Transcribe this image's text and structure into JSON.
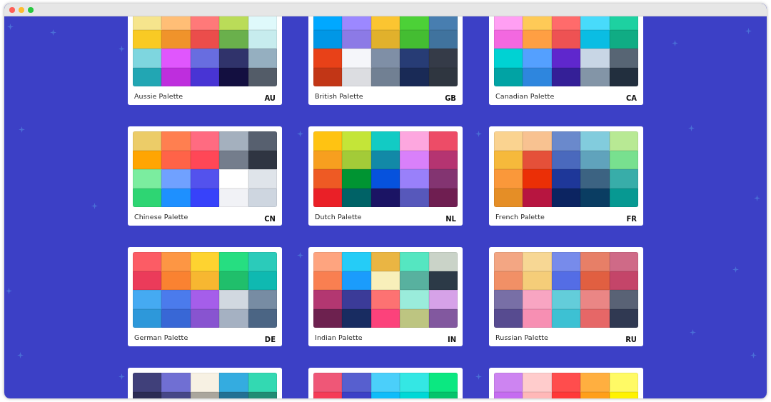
{
  "palettes": [
    {
      "name": "Aussie Palette",
      "code": "AU",
      "swatches": [
        {
          "color": "#f6e58d"
        },
        {
          "color": "#ffbe76"
        },
        {
          "color": "#ff7979"
        },
        {
          "color": "#badc58"
        },
        {
          "color": "#dff9fb"
        },
        {
          "color": "#f9ca24"
        },
        {
          "color": "#f0932b"
        },
        {
          "color": "#eb4d4b"
        },
        {
          "color": "#6ab04c"
        },
        {
          "color": "#c7ecee"
        },
        {
          "color": "#7ed6df"
        },
        {
          "color": "#e056fd"
        },
        {
          "color": "#686de0"
        },
        {
          "color": "#30336b"
        },
        {
          "color": "#95afc0"
        },
        {
          "color": "#22a6b3"
        },
        {
          "color": "#be2edd"
        },
        {
          "color": "#4834d4"
        },
        {
          "color": "#130f40"
        },
        {
          "color": "#535c68"
        }
      ]
    },
    {
      "name": "British Palette",
      "code": "GB",
      "swatches": [
        {
          "color": "#00a8ff"
        },
        {
          "color": "#9c88ff"
        },
        {
          "color": "#fbc531"
        },
        {
          "color": "#4cd137"
        },
        {
          "color": "#487eb0"
        },
        {
          "color": "#0097e6"
        },
        {
          "color": "#8c7ae6"
        },
        {
          "color": "#e1b12c"
        },
        {
          "color": "#44bd32"
        },
        {
          "color": "#40739e"
        },
        {
          "color": "#e84118"
        },
        {
          "color": "#f5f6fa"
        },
        {
          "color": "#7f8fa6"
        },
        {
          "color": "#273c75"
        },
        {
          "color": "#353b48"
        },
        {
          "color": "#c23616"
        },
        {
          "color": "#dcdde1"
        },
        {
          "color": "#718093"
        },
        {
          "color": "#192a56"
        },
        {
          "color": "#2f3640"
        }
      ]
    },
    {
      "name": "Canadian Palette",
      "code": "CA",
      "swatches": [
        {
          "color": "#ff9ff3"
        },
        {
          "color": "#feca57"
        },
        {
          "color": "#ff6b6b"
        },
        {
          "color": "#48dbfb"
        },
        {
          "color": "#1dd1a1"
        },
        {
          "color": "#f368e0"
        },
        {
          "color": "#ff9f43"
        },
        {
          "color": "#ee5253"
        },
        {
          "color": "#0abde3"
        },
        {
          "color": "#10ac84"
        },
        {
          "color": "#00d2d3"
        },
        {
          "color": "#54a0ff"
        },
        {
          "color": "#5f27cd"
        },
        {
          "color": "#c8d6e5"
        },
        {
          "color": "#576574"
        },
        {
          "color": "#01a3a4"
        },
        {
          "color": "#2e86de"
        },
        {
          "color": "#341f97"
        },
        {
          "color": "#8395a7"
        },
        {
          "color": "#222f3e"
        }
      ]
    },
    {
      "name": "Chinese Palette",
      "code": "CN",
      "swatches": [
        {
          "color": "#eccc68"
        },
        {
          "color": "#ff7f50"
        },
        {
          "color": "#ff6b81"
        },
        {
          "color": "#a4b0be"
        },
        {
          "color": "#57606f"
        },
        {
          "color": "#ffa502"
        },
        {
          "color": "#ff6348"
        },
        {
          "color": "#ff4757"
        },
        {
          "color": "#747d8c"
        },
        {
          "color": "#2f3542"
        },
        {
          "color": "#7bed9f"
        },
        {
          "color": "#70a1ff"
        },
        {
          "color": "#5352ed"
        },
        {
          "color": "#ffffff"
        },
        {
          "color": "#dfe4ea"
        },
        {
          "color": "#2ed573"
        },
        {
          "color": "#1e90ff"
        },
        {
          "color": "#3742fa"
        },
        {
          "color": "#f1f2f6"
        },
        {
          "color": "#ced6e0"
        }
      ]
    },
    {
      "name": "Dutch Palette",
      "code": "NL",
      "swatches": [
        {
          "color": "#ffc312"
        },
        {
          "color": "#c4e538"
        },
        {
          "color": "#12cbc4"
        },
        {
          "color": "#fda7df"
        },
        {
          "color": "#ed4c67"
        },
        {
          "color": "#f79f1f"
        },
        {
          "color": "#a3cb38"
        },
        {
          "color": "#1289a7"
        },
        {
          "color": "#d980fa"
        },
        {
          "color": "#b53471"
        },
        {
          "color": "#ee5a24"
        },
        {
          "color": "#009432"
        },
        {
          "color": "#0652dd"
        },
        {
          "color": "#9980fa"
        },
        {
          "color": "#833471"
        },
        {
          "color": "#ea2027"
        },
        {
          "color": "#006266"
        },
        {
          "color": "#1b1464"
        },
        {
          "color": "#5758bb"
        },
        {
          "color": "#6f1e51"
        }
      ]
    },
    {
      "name": "French Palette",
      "code": "FR",
      "swatches": [
        {
          "color": "#fad390"
        },
        {
          "color": "#f8c291"
        },
        {
          "color": "#6a89cc"
        },
        {
          "color": "#82ccdd"
        },
        {
          "color": "#b8e994"
        },
        {
          "color": "#f6b93b"
        },
        {
          "color": "#e55039"
        },
        {
          "color": "#4a69bd"
        },
        {
          "color": "#60a3bc"
        },
        {
          "color": "#78e08f"
        },
        {
          "color": "#fa983a"
        },
        {
          "color": "#eb2f06"
        },
        {
          "color": "#1e3799"
        },
        {
          "color": "#3c6382"
        },
        {
          "color": "#38ada9"
        },
        {
          "color": "#e58e26"
        },
        {
          "color": "#b71540"
        },
        {
          "color": "#0c2461"
        },
        {
          "color": "#0a3d62"
        },
        {
          "color": "#079992"
        }
      ]
    },
    {
      "name": "German Palette",
      "code": "DE",
      "swatches": [
        {
          "color": "#fc5c65"
        },
        {
          "color": "#fd9644"
        },
        {
          "color": "#fed330"
        },
        {
          "color": "#26de81"
        },
        {
          "color": "#2bcbba"
        },
        {
          "color": "#eb3b5a"
        },
        {
          "color": "#fa8231"
        },
        {
          "color": "#f7b731"
        },
        {
          "color": "#20bf6b"
        },
        {
          "color": "#0fb9b1"
        },
        {
          "color": "#45aaf2"
        },
        {
          "color": "#4b7bec"
        },
        {
          "color": "#a55eea"
        },
        {
          "color": "#d1d8e0"
        },
        {
          "color": "#778ca3"
        },
        {
          "color": "#2d98da"
        },
        {
          "color": "#3867d6"
        },
        {
          "color": "#8854d0"
        },
        {
          "color": "#a5b1c2"
        },
        {
          "color": "#4b6584"
        }
      ]
    },
    {
      "name": "Indian Palette",
      "code": "IN",
      "swatches": [
        {
          "color": "#fea47f"
        },
        {
          "color": "#25ccf7"
        },
        {
          "color": "#eab543"
        },
        {
          "color": "#55e6c1"
        },
        {
          "color": "#cad3c8"
        },
        {
          "color": "#f97f51"
        },
        {
          "color": "#1b9cfc"
        },
        {
          "color": "#f8efba"
        },
        {
          "color": "#58b19f"
        },
        {
          "color": "#2c3a47"
        },
        {
          "color": "#b33771"
        },
        {
          "color": "#3b3b98"
        },
        {
          "color": "#fd7272"
        },
        {
          "color": "#9aecdb"
        },
        {
          "color": "#d6a2e8"
        },
        {
          "color": "#6d214f"
        },
        {
          "color": "#182c61"
        },
        {
          "color": "#fc427b"
        },
        {
          "color": "#bdc581"
        },
        {
          "color": "#82589f"
        }
      ]
    },
    {
      "name": "Russian Palette",
      "code": "RU",
      "swatches": [
        {
          "color": "#f3a683"
        },
        {
          "color": "#f7d794"
        },
        {
          "color": "#778beb"
        },
        {
          "color": "#e77f67"
        },
        {
          "color": "#cf6a87"
        },
        {
          "color": "#f19066"
        },
        {
          "color": "#f5cd79"
        },
        {
          "color": "#546de5"
        },
        {
          "color": "#e15f41"
        },
        {
          "color": "#c44569"
        },
        {
          "color": "#786fa6"
        },
        {
          "color": "#f8a5c2"
        },
        {
          "color": "#63cdda"
        },
        {
          "color": "#ea8685"
        },
        {
          "color": "#596275"
        },
        {
          "color": "#574b90"
        },
        {
          "color": "#f78fb3"
        },
        {
          "color": "#3dc1d3"
        },
        {
          "color": "#e66767"
        },
        {
          "color": "#303952"
        }
      ]
    },
    {
      "swatches": [
        {
          "color": "#40407a"
        },
        {
          "color": "#706fd3"
        },
        {
          "color": "#f7f1e3"
        },
        {
          "color": "#34ace0"
        },
        {
          "color": "#33d9b2"
        },
        {
          "color": "#2c2c54"
        },
        {
          "color": "#474787"
        },
        {
          "color": "#aaa69d"
        },
        {
          "color": "#227093"
        },
        {
          "color": "#218c74"
        }
      ]
    },
    {
      "swatches": [
        {
          "color": "#ef5777"
        },
        {
          "color": "#575fcf"
        },
        {
          "color": "#4bcffa"
        },
        {
          "color": "#34e7e4"
        },
        {
          "color": "#0be881"
        },
        {
          "color": "#f53b57"
        },
        {
          "color": "#3c40c6"
        },
        {
          "color": "#0fbcf9"
        },
        {
          "color": "#00d8d6"
        },
        {
          "color": "#05c46b"
        }
      ]
    },
    {
      "swatches": [
        {
          "color": "#cd84f1"
        },
        {
          "color": "#ffcccc"
        },
        {
          "color": "#ff4d4d"
        },
        {
          "color": "#ffaf40"
        },
        {
          "color": "#fffa65"
        },
        {
          "color": "#c56cf0"
        },
        {
          "color": "#ffb8b8"
        },
        {
          "color": "#ff3838"
        },
        {
          "color": "#ff9f1a"
        },
        {
          "color": "#fff200"
        }
      ]
    }
  ]
}
